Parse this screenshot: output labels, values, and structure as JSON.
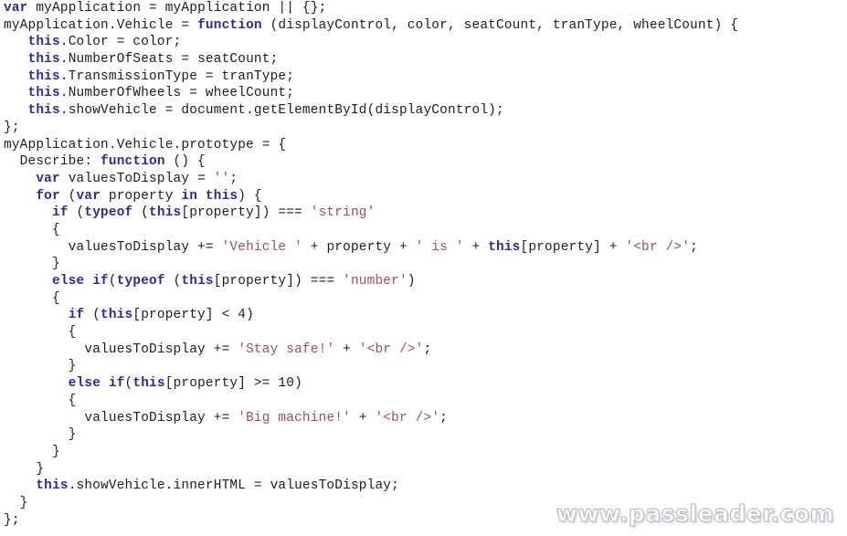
{
  "document": {
    "title": "JavaScript Code Listing",
    "language": "javascript",
    "background_color": "#ffffff",
    "colors": {
      "plain_text": "#1c1c1c",
      "keyword": "#2c2c96",
      "string_literal": "#9c4f53",
      "watermark": "#ffffff",
      "watermark_outline": "#b9bcc4"
    }
  },
  "watermark": {
    "text": "www.passleader.com"
  },
  "code": {
    "lines": [
      [
        {
          "t": "var",
          "c": "keyword"
        },
        {
          "t": " myApplication = myApplication || {};",
          "c": "plain"
        }
      ],
      [
        {
          "t": "myApplication.Vehicle = ",
          "c": "plain"
        },
        {
          "t": "function",
          "c": "keyword"
        },
        {
          "t": " (displayControl, color, seatCount, tranType, wheelCount) {",
          "c": "plain"
        }
      ],
      [
        {
          "t": "   ",
          "c": "plain"
        },
        {
          "t": "this",
          "c": "keyword"
        },
        {
          "t": ".Color = color;",
          "c": "plain"
        }
      ],
      [
        {
          "t": "   ",
          "c": "plain"
        },
        {
          "t": "this",
          "c": "keyword"
        },
        {
          "t": ".NumberOfSeats = seatCount;",
          "c": "plain"
        }
      ],
      [
        {
          "t": "   ",
          "c": "plain"
        },
        {
          "t": "this",
          "c": "keyword"
        },
        {
          "t": ".TransmissionType = tranType;",
          "c": "plain"
        }
      ],
      [
        {
          "t": "   ",
          "c": "plain"
        },
        {
          "t": "this",
          "c": "keyword"
        },
        {
          "t": ".NumberOfWheels = wheelCount;",
          "c": "plain"
        }
      ],
      [
        {
          "t": "   ",
          "c": "plain"
        },
        {
          "t": "this",
          "c": "keyword"
        },
        {
          "t": ".showVehicle = document.getElementById(displayControl);",
          "c": "plain"
        }
      ],
      [
        {
          "t": "};",
          "c": "plain"
        }
      ],
      [
        {
          "t": "myApplication.Vehicle.prototype = {",
          "c": "plain"
        }
      ],
      [
        {
          "t": "  Describe: ",
          "c": "plain"
        },
        {
          "t": "function",
          "c": "keyword"
        },
        {
          "t": " () {",
          "c": "plain"
        }
      ],
      [
        {
          "t": "    ",
          "c": "plain"
        },
        {
          "t": "var",
          "c": "keyword"
        },
        {
          "t": " valuesToDisplay = ",
          "c": "plain"
        },
        {
          "t": "''",
          "c": "string"
        },
        {
          "t": ";",
          "c": "plain"
        }
      ],
      [
        {
          "t": "    ",
          "c": "plain"
        },
        {
          "t": "for",
          "c": "keyword"
        },
        {
          "t": " (",
          "c": "plain"
        },
        {
          "t": "var",
          "c": "keyword"
        },
        {
          "t": " property ",
          "c": "plain"
        },
        {
          "t": "in",
          "c": "keyword"
        },
        {
          "t": " ",
          "c": "plain"
        },
        {
          "t": "this",
          "c": "keyword"
        },
        {
          "t": ") {",
          "c": "plain"
        }
      ],
      [
        {
          "t": "      ",
          "c": "plain"
        },
        {
          "t": "if",
          "c": "keyword"
        },
        {
          "t": " (",
          "c": "plain"
        },
        {
          "t": "typeof",
          "c": "keyword"
        },
        {
          "t": " (",
          "c": "plain"
        },
        {
          "t": "this",
          "c": "keyword"
        },
        {
          "t": "[property]) === ",
          "c": "plain"
        },
        {
          "t": "'string'",
          "c": "string"
        }
      ],
      [
        {
          "t": "      {",
          "c": "plain"
        }
      ],
      [
        {
          "t": "        valuesToDisplay += ",
          "c": "plain"
        },
        {
          "t": "'Vehicle '",
          "c": "string"
        },
        {
          "t": " + property + ",
          "c": "plain"
        },
        {
          "t": "' is '",
          "c": "string"
        },
        {
          "t": " + ",
          "c": "plain"
        },
        {
          "t": "this",
          "c": "keyword"
        },
        {
          "t": "[property] + ",
          "c": "plain"
        },
        {
          "t": "'<br />'",
          "c": "string"
        },
        {
          "t": ";",
          "c": "plain"
        }
      ],
      [
        {
          "t": "      }",
          "c": "plain"
        }
      ],
      [
        {
          "t": "      ",
          "c": "plain"
        },
        {
          "t": "else",
          "c": "keyword"
        },
        {
          "t": " ",
          "c": "plain"
        },
        {
          "t": "if",
          "c": "keyword"
        },
        {
          "t": "(",
          "c": "plain"
        },
        {
          "t": "typeof",
          "c": "keyword"
        },
        {
          "t": " (",
          "c": "plain"
        },
        {
          "t": "this",
          "c": "keyword"
        },
        {
          "t": "[property]) === ",
          "c": "plain"
        },
        {
          "t": "'number'",
          "c": "string"
        },
        {
          "t": ")",
          "c": "plain"
        }
      ],
      [
        {
          "t": "      {",
          "c": "plain"
        }
      ],
      [
        {
          "t": "        ",
          "c": "plain"
        },
        {
          "t": "if",
          "c": "keyword"
        },
        {
          "t": " (",
          "c": "plain"
        },
        {
          "t": "this",
          "c": "keyword"
        },
        {
          "t": "[property] < 4)",
          "c": "plain"
        }
      ],
      [
        {
          "t": "        {",
          "c": "plain"
        }
      ],
      [
        {
          "t": "          valuesToDisplay += ",
          "c": "plain"
        },
        {
          "t": "'Stay safe!'",
          "c": "string"
        },
        {
          "t": " + ",
          "c": "plain"
        },
        {
          "t": "'<br />'",
          "c": "string"
        },
        {
          "t": ";",
          "c": "plain"
        }
      ],
      [
        {
          "t": "        }",
          "c": "plain"
        }
      ],
      [
        {
          "t": "        ",
          "c": "plain"
        },
        {
          "t": "else",
          "c": "keyword"
        },
        {
          "t": " ",
          "c": "plain"
        },
        {
          "t": "if",
          "c": "keyword"
        },
        {
          "t": "(",
          "c": "plain"
        },
        {
          "t": "this",
          "c": "keyword"
        },
        {
          "t": "[property] >= 10)",
          "c": "plain"
        }
      ],
      [
        {
          "t": "        {",
          "c": "plain"
        }
      ],
      [
        {
          "t": "          valuesToDisplay += ",
          "c": "plain"
        },
        {
          "t": "'Big machine!'",
          "c": "string"
        },
        {
          "t": " + ",
          "c": "plain"
        },
        {
          "t": "'<br />'",
          "c": "string"
        },
        {
          "t": ";",
          "c": "plain"
        }
      ],
      [
        {
          "t": "        }",
          "c": "plain"
        }
      ],
      [
        {
          "t": "      }",
          "c": "plain"
        }
      ],
      [
        {
          "t": "    }",
          "c": "plain"
        }
      ],
      [
        {
          "t": "    ",
          "c": "plain"
        },
        {
          "t": "this",
          "c": "keyword"
        },
        {
          "t": ".showVehicle.innerHTML = valuesToDisplay;",
          "c": "plain"
        }
      ],
      [
        {
          "t": "  }",
          "c": "plain"
        }
      ],
      [
        {
          "t": "};",
          "c": "plain"
        }
      ]
    ]
  }
}
